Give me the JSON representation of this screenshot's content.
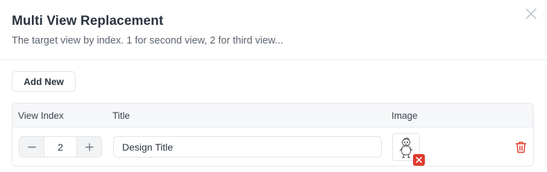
{
  "dialog": {
    "title": "Multi View Replacement",
    "subtitle": "The target view by index. 1 for second view, 2 for third view...",
    "close_icon": "close-icon"
  },
  "toolbar": {
    "add_label": "Add New"
  },
  "table": {
    "columns": [
      "View Index",
      "Title",
      "Image"
    ],
    "rows": [
      {
        "view_index": "2",
        "title": "Design Title",
        "image_icon": "sketch-figure-thumbnail",
        "remove_icon": "remove-image-icon",
        "delete_icon": "trash-icon"
      }
    ]
  },
  "colors": {
    "danger": "#e03b2f",
    "border": "#e4e7eb",
    "header_bg": "#f6f7f9",
    "text": "#2b3440",
    "muted": "#5b6470"
  }
}
